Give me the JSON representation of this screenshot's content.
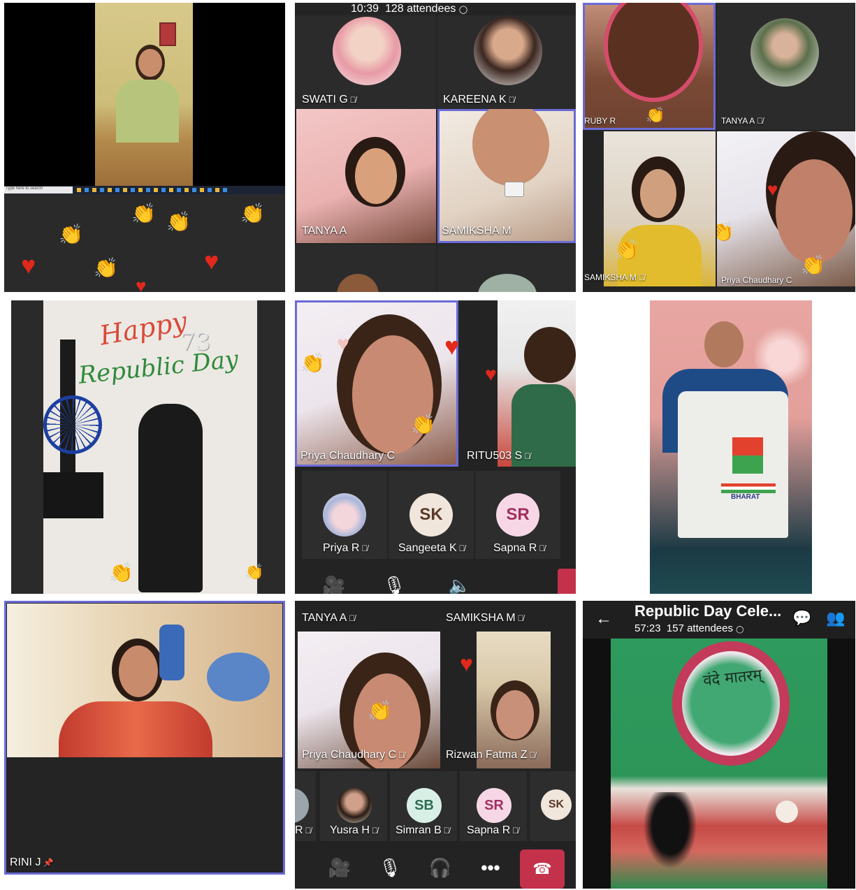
{
  "panel1": {
    "taskbar_search": "Type here to search"
  },
  "panel2": {
    "status": {
      "time": "10:39",
      "attendees": "128 attendees"
    },
    "tiles": [
      {
        "name": "SWATI G"
      },
      {
        "name": "KAREENA K"
      },
      {
        "name": "TANYA A"
      },
      {
        "name": "SAMIKSHA M"
      }
    ]
  },
  "panel3": {
    "tiles": [
      {
        "name": "RUBY R"
      },
      {
        "name": "TANYA A"
      },
      {
        "name": "SAMIKSHA M"
      },
      {
        "name": "Priya Chaudhary C"
      }
    ]
  },
  "panel4": {
    "poster_line1": "Happy",
    "poster_line2": "Republic Day",
    "poster_number": "73"
  },
  "panel5": {
    "tiles": [
      {
        "name": "Priya Chaudhary C"
      },
      {
        "name": "RITU503 S"
      }
    ],
    "participants": [
      {
        "name": "Priya R",
        "initials": ""
      },
      {
        "name": "Sangeeta K",
        "initials": "SK",
        "color": "#f1e6dc",
        "text_color": "#5a3a2a"
      },
      {
        "name": "Sapna R",
        "initials": "SR",
        "color": "#f7d7e6",
        "text_color": "#a0305f"
      }
    ]
  },
  "panel6": {
    "shirt_text": "BHARAT"
  },
  "panel7": {
    "name": "RINI J"
  },
  "panel8": {
    "tiles": [
      {
        "name": "TANYA A"
      },
      {
        "name": "SAMIKSHA M"
      },
      {
        "name": "Priya Chaudhary C"
      },
      {
        "name": "Rizwan Fatma Z"
      }
    ],
    "participants": [
      {
        "name": "R",
        "initials": ""
      },
      {
        "name": "Yusra H",
        "initials": ""
      },
      {
        "name": "Simran B",
        "initials": "SB",
        "color": "#d8efe6",
        "text_color": "#2e6b55"
      },
      {
        "name": "Sapna R",
        "initials": "SR",
        "color": "#f7d7e6",
        "text_color": "#a0305f"
      },
      {
        "name": "",
        "initials": "SK",
        "color": "#f1e6dc",
        "text_color": "#5a3a2a"
      }
    ],
    "colors": {
      "end_call": "#c4314b"
    }
  },
  "panel9": {
    "meeting_title": "Republic Day Cele...",
    "duration": "57:23",
    "attendees": "157 attendees",
    "artwork_text": "वंदे मातरम्"
  }
}
